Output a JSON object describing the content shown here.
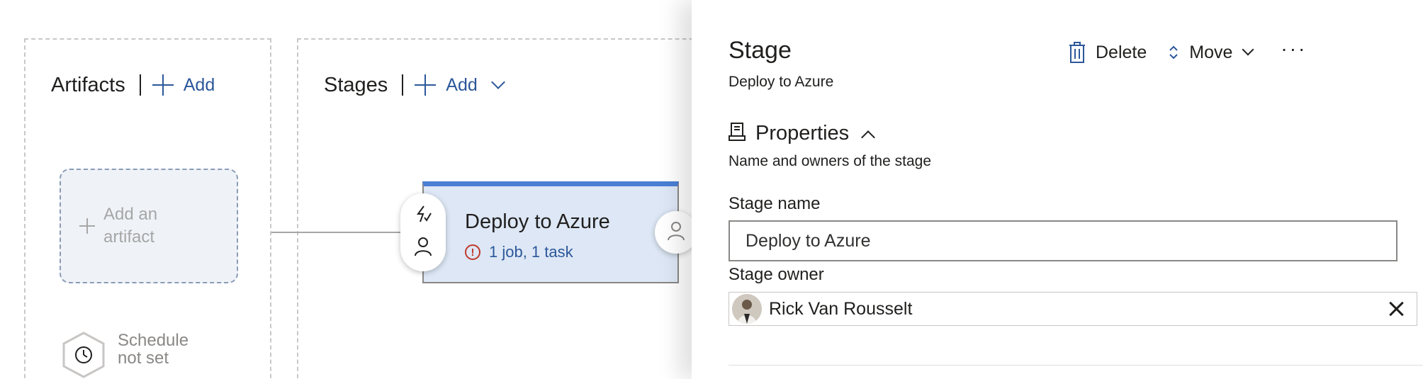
{
  "canvas": {
    "artifacts": {
      "title": "Artifacts",
      "add_label": "Add"
    },
    "stages": {
      "title": "Stages",
      "add_label": "Add"
    },
    "add_artifact_label": "Add an artifact",
    "schedule_label": "Schedule not set",
    "stage_card": {
      "title": "Deploy to Azure",
      "subtitle": "1 job, 1 task",
      "accent_color": "#4a7fd4",
      "warning_color": "#c0392b"
    }
  },
  "panel": {
    "title": "Stage",
    "subtitle": "Deploy to Azure",
    "toolbar": {
      "delete_label": "Delete",
      "move_label": "Move",
      "more_label": "···"
    },
    "properties": {
      "title": "Properties",
      "description": "Name and owners of the stage"
    },
    "stage_name": {
      "label": "Stage name",
      "value": "Deploy to Azure"
    },
    "stage_owner": {
      "label": "Stage owner",
      "value": "Rick Van Rousselt"
    }
  },
  "icons": [
    "plus-icon",
    "chevron-down-icon",
    "clock-icon",
    "warning-icon",
    "trigger-icon",
    "person-icon",
    "trash-icon",
    "move-updown-icon",
    "more-icon",
    "properties-icon",
    "chevron-up-icon",
    "close-icon"
  ],
  "colors": {
    "link": "#2b579a",
    "card_bg": "#dde7f5",
    "dashed_border": "#c8c8c8"
  }
}
